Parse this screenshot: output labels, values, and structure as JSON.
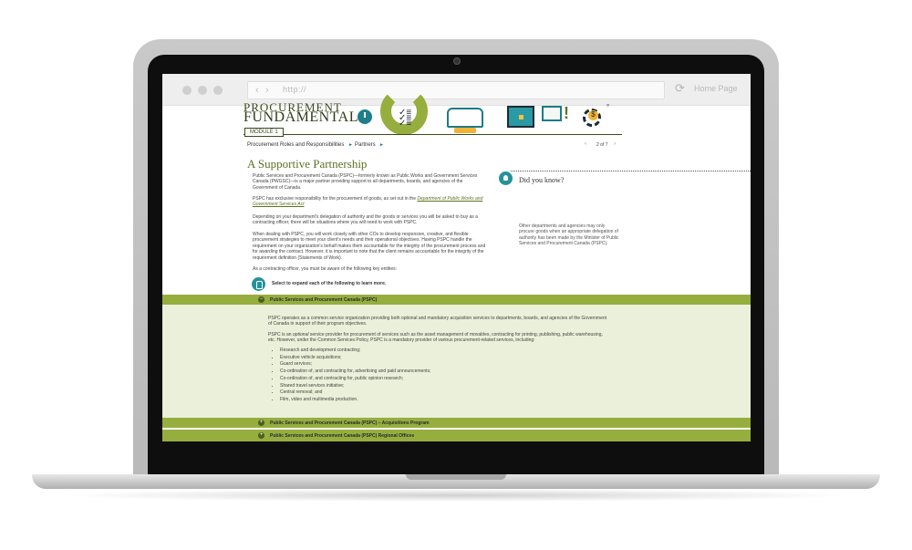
{
  "browser": {
    "url": "http://",
    "home_label": "Home Page"
  },
  "header": {
    "brand_line1": "PROCUREMENT",
    "brand_line2": "FUNDAMENTALS",
    "module_badge": "MODULE 1",
    "breadcrumb": [
      "Procurement Roles and Responsibilities",
      "Partners"
    ],
    "pager": "2 of 7",
    "pager_prev": "‹",
    "pager_next": "›"
  },
  "page": {
    "title": "A Supportive Partnership",
    "paragraphs": [
      "Public Services and Procurement Canada (PSPC)—formerly known as Public Works and Government Services Canada (PWGSC)—is a major partner providing support to all departments, boards, and agencies of the Government of Canada.",
      "PSPC has exclusive responsibility for the procurement of goods, as set out in the",
      "Department of Public Works and Government Services Act",
      "Depending on your department's delegation of authority and the goods or services you will be asked to buy as a contracting officer, there will be situations where you will need to work with PSPC.",
      "When dealing with PSPC, you will work closely with other COs to develop responsive, creative, and flexible procurement strategies to meet your client's needs and their operational objectives. Having PSPC handle the requirement on your organization's behalf makes them accountable for the integrity of the procurement process and for awarding the contract. However, it is important to note that the client remains accountable for the integrity of the requirement definition (Statements of Work).",
      "As a contracting officer, you must be aware of the following key entities:"
    ],
    "expand_instruction": "Select to expand each of the following to learn more."
  },
  "did_you_know": {
    "title": "Did you know?",
    "body": "Other departments and agencies may only procure goods when an appropriate delegation of authority has been made by the Minister of Public Services and Procurement Canada (PSPC)."
  },
  "accordion": {
    "sections": [
      {
        "label": "Public Services and Procurement Canada (PSPC)",
        "toggle": "−"
      },
      {
        "label": "Public Services and Procurement Canada (PSPC) – Acquisitions Program",
        "toggle": "+"
      },
      {
        "label": "Public Services and Procurement Canada (PSPC) Regional Offices",
        "toggle": "+"
      }
    ],
    "expanded": {
      "intro": "PSPC operates as a common service organization providing both optional and mandatory acquisition services to departments, boards, and agencies of the Government of Canada in support of their program objectives.",
      "detail_a": "PSPC is an ",
      "detail_em": "optional",
      "detail_b": " service provider for procurement of services such as the asset management of movables, contracting for printing, publishing, public warehousing, etc. However, under the Common Services Policy, PSPC is a mandatory provider of various procurement-related services, including:",
      "items": [
        "Research and development contracting;",
        "Executive vehicle acquisitions;",
        "Guard services;",
        "Co-ordination of, and contracting for, advertising and paid announcements;",
        "Co-ordination of, and contracting for, public opinion research;",
        "Shared travel services initiative;",
        "Central removal; and",
        "Film, video and multimedia production."
      ]
    }
  },
  "colors": {
    "accent_green": "#96ae3d",
    "teal": "#25929b",
    "panel_bg": "#eaf0d9"
  },
  "icons": [
    "clock-icon",
    "checklist-icon",
    "hands-icon",
    "briefcase-icon",
    "document-icon",
    "exclamation-icon",
    "gear-dollar-icon",
    "lock-icon",
    "lightbulb-icon",
    "reload-icon"
  ]
}
